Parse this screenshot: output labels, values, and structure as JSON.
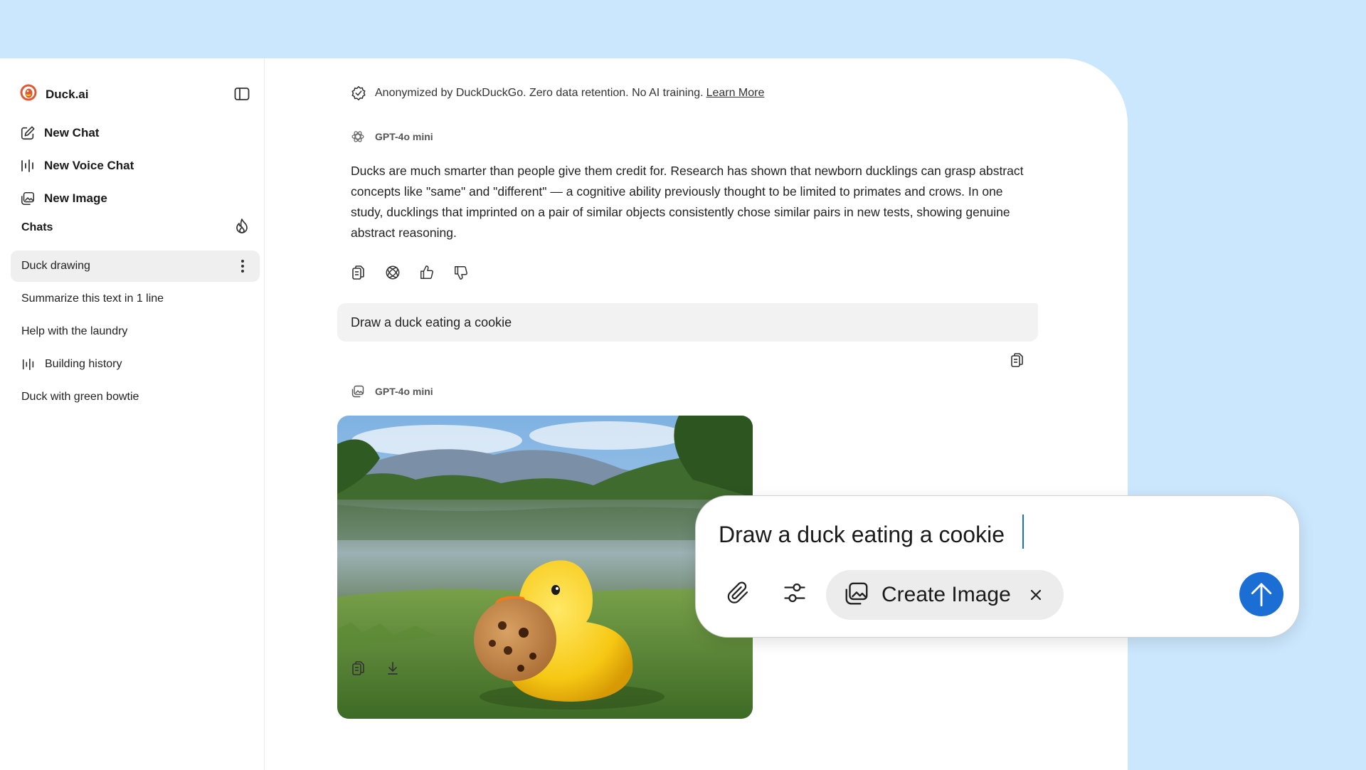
{
  "sidebar": {
    "brand": "Duck.ai",
    "nav": [
      {
        "label": "New Chat",
        "icon": "pencil-icon"
      },
      {
        "label": "New Voice Chat",
        "icon": "waveform-icon"
      },
      {
        "label": "New Image",
        "icon": "image-sparkle-icon"
      }
    ],
    "chats_heading": "Chats",
    "chats": [
      {
        "label": "Duck drawing",
        "active": true
      },
      {
        "label": "Summarize this text in 1 line"
      },
      {
        "label": "Help with the laundry"
      },
      {
        "label": "Building history",
        "icon": "waveform-icon"
      },
      {
        "label": "Duck with green bowtie"
      }
    ]
  },
  "main": {
    "privacy_text": "Anonymized by DuckDuckGo. Zero data retention. No AI training.",
    "privacy_link": "Learn More",
    "assistant_model": "GPT-4o mini",
    "assistant_message": "Ducks are much smarter than people give them credit for. Research has shown that newborn ducklings can grasp abstract concepts like \"same\" and \"different\" — a cognitive ability previously thought to be limited to primates and crows. In one study, ducklings that imprinted on a pair of similar objects consistently chose similar pairs in new tests, showing genuine abstract reasoning.",
    "user_message": "Draw a duck eating a cookie",
    "image_model": "GPT-4o mini"
  },
  "composer": {
    "input_value": "Draw a duck eating a cookie",
    "mode_label": "Create Image"
  },
  "colors": {
    "background": "#cbe7fd",
    "accent": "#1b6fd4",
    "bubble": "#f2f2f2"
  }
}
